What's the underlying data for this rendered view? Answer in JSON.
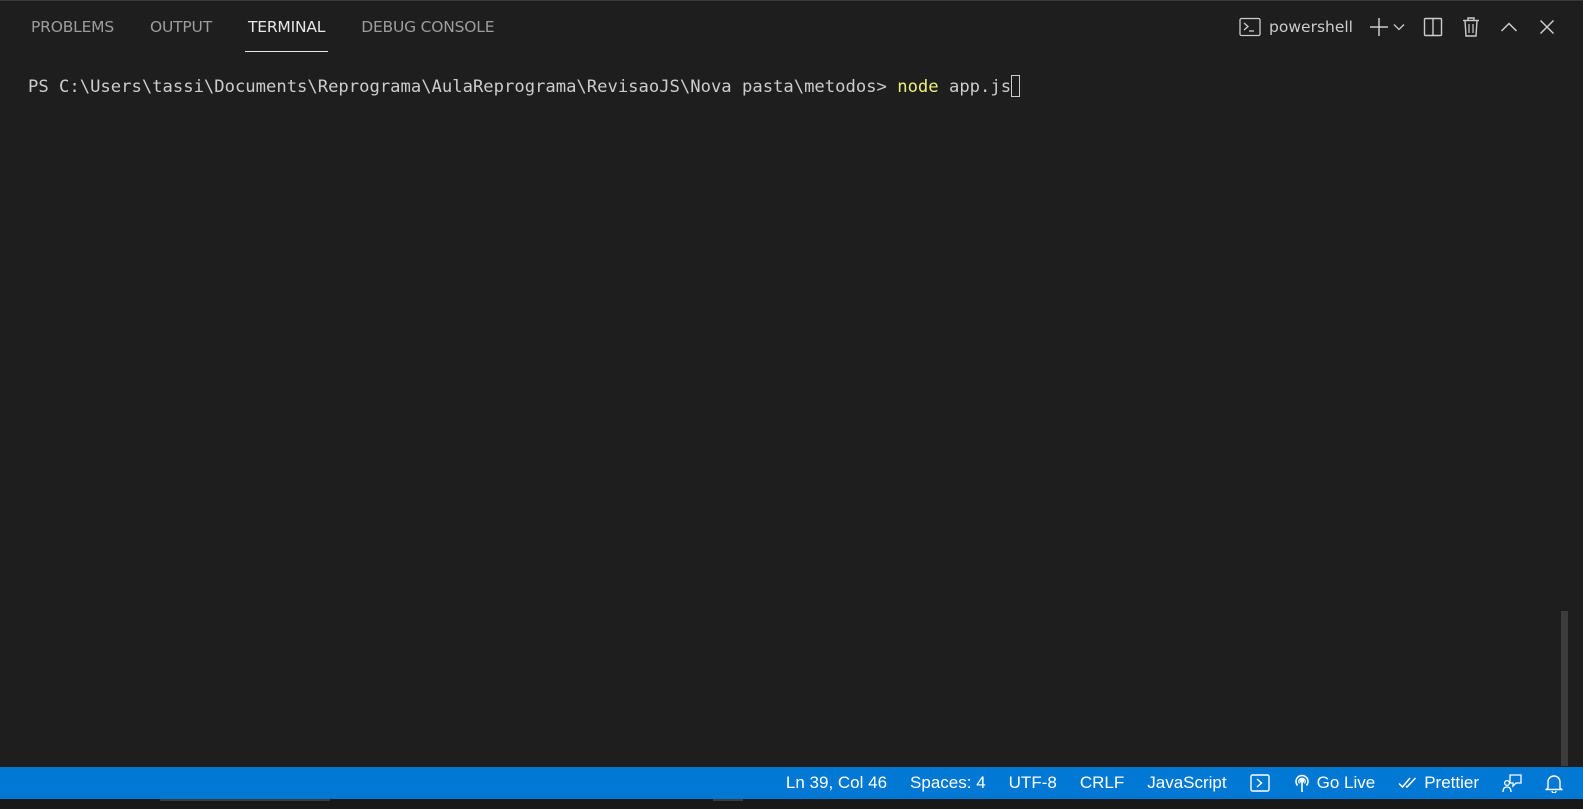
{
  "panel": {
    "tabs": [
      {
        "label": "PROBLEMS",
        "active": false
      },
      {
        "label": "OUTPUT",
        "active": false
      },
      {
        "label": "TERMINAL",
        "active": true
      },
      {
        "label": "DEBUG CONSOLE",
        "active": false
      }
    ],
    "shell_name": "powershell",
    "actions": {
      "shell_icon": "terminal-icon",
      "new_terminal_icon": "plus-icon",
      "launch_profile_icon": "chevron-down-icon",
      "split_icon": "split-terminal-icon",
      "kill_icon": "trash-icon",
      "maximize_icon": "chevron-up-icon",
      "close_icon": "close-icon"
    }
  },
  "terminal": {
    "prompt": "PS C:\\Users\\tassi\\Documents\\Reprograma\\AulaReprograma\\RevisaoJS\\Nova pasta\\metodos> ",
    "command": "node",
    "args": " app.js"
  },
  "statusbar": {
    "background": "#0078d4",
    "cursor_position": "Ln 39, Col 46",
    "indentation": "Spaces: 4",
    "encoding": "UTF-8",
    "line_ending": "CRLF",
    "language": "JavaScript",
    "terminal_icon": "terminal-icon",
    "go_live": "Go Live",
    "go_live_icon": "broadcast-icon",
    "prettier": "Prettier",
    "prettier_icon": "double-check-icon",
    "feedback_icon": "feedback-icon",
    "notifications_icon": "bell-icon"
  },
  "colors": {
    "background": "#1e1e1e",
    "command_highlight": "#f0f07a",
    "text": "#cccccc"
  }
}
